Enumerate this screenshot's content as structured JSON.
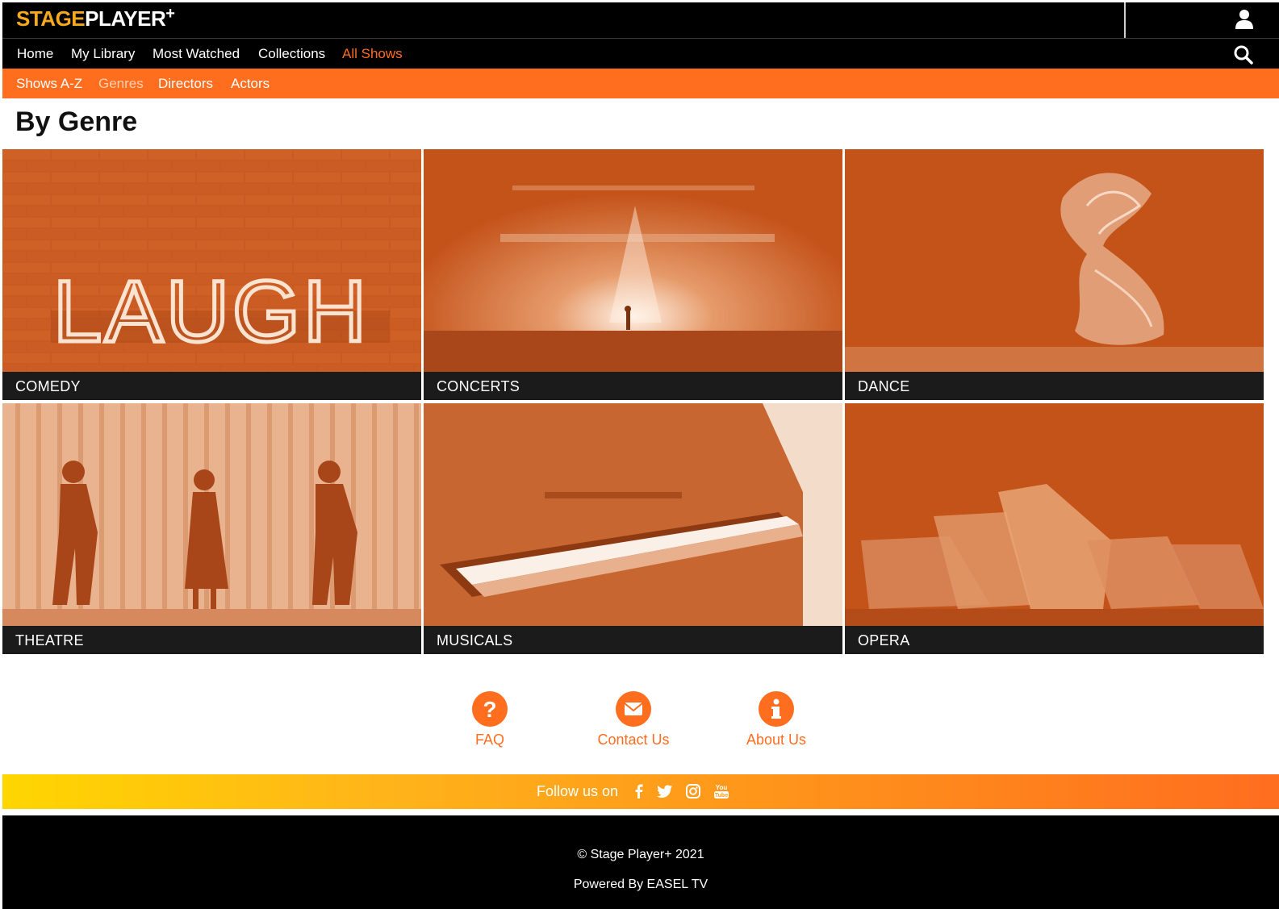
{
  "brand": {
    "logo_stage": "STAGE",
    "logo_player": "PLAYER",
    "logo_plus": "+"
  },
  "mainnav": {
    "items": [
      {
        "label": "Home"
      },
      {
        "label": "My Library"
      },
      {
        "label": "Most Watched"
      },
      {
        "label": "Collections"
      },
      {
        "label": "All Shows"
      }
    ],
    "active": "All Shows"
  },
  "subnav": {
    "items": [
      {
        "label": "Shows A-Z"
      },
      {
        "label": "Genres"
      },
      {
        "label": "Directors"
      },
      {
        "label": "Actors"
      }
    ],
    "active": "Genres"
  },
  "page": {
    "title": "By Genre"
  },
  "genres": [
    {
      "label": "COMEDY",
      "image_text": "LAUGH"
    },
    {
      "label": "CONCERTS"
    },
    {
      "label": "DANCE"
    },
    {
      "label": "THEATRE"
    },
    {
      "label": "MUSICALS"
    },
    {
      "label": "OPERA"
    }
  ],
  "footer_links": [
    {
      "label": "FAQ",
      "icon": "question-icon"
    },
    {
      "label": "Contact Us",
      "icon": "envelope-icon"
    },
    {
      "label": "About Us",
      "icon": "info-icon"
    }
  ],
  "follow": {
    "label": "Follow us on",
    "socials": [
      "facebook-icon",
      "twitter-icon",
      "instagram-icon",
      "youtube-icon"
    ]
  },
  "footer": {
    "copyright": "© Stage Player+ 2021",
    "powered": "Powered By EASEL TV"
  },
  "colors": {
    "accent": "#ff6d1f",
    "logo_orange": "#f6a91c",
    "tile_tint": "#c4531a",
    "caption_bg": "#1b1b1b"
  }
}
